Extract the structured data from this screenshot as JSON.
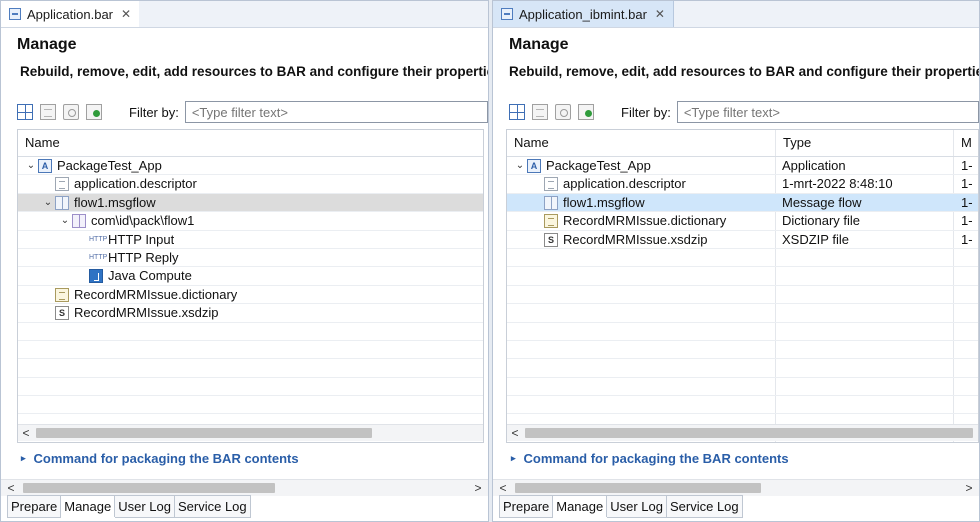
{
  "left": {
    "tab_title": "Application.bar",
    "manage_title": "Manage",
    "manage_desc": "Rebuild, remove, edit, add resources to BAR and configure their properties",
    "filter_label": "Filter by:",
    "filter_placeholder": "<Type filter text>",
    "columns": {
      "name": "Name"
    },
    "rows": [
      {
        "label": "PackageTest_App",
        "icon": "application-icon",
        "twisty": "expanded"
      },
      {
        "label": "application.descriptor",
        "icon": "descriptor-icon",
        "twisty": ""
      },
      {
        "label": "flow1.msgflow",
        "icon": "message-flow-icon",
        "twisty": "expanded"
      },
      {
        "label": "com\\id\\pack\\flow1",
        "icon": "package-icon",
        "twisty": "expanded"
      },
      {
        "label": "HTTP Input",
        "icon": "http-input-icon",
        "twisty": ""
      },
      {
        "label": "HTTP Reply",
        "icon": "http-reply-icon",
        "twisty": ""
      },
      {
        "label": "Java Compute",
        "icon": "java-compute-icon",
        "twisty": ""
      },
      {
        "label": "RecordMRMIssue.dictionary",
        "icon": "dictionary-icon",
        "twisty": ""
      },
      {
        "label": "RecordMRMIssue.xsdzip",
        "icon": "xsdzip-icon",
        "twisty": ""
      }
    ],
    "command_label": "Command for packaging the BAR contents",
    "bottom_tabs": [
      "Prepare",
      "Manage",
      "User Log",
      "Service Log"
    ],
    "active_tab": "Manage"
  },
  "right": {
    "tab_title": "Application_ibmint.bar",
    "manage_title": "Manage",
    "manage_desc": "Rebuild, remove, edit, add resources to BAR and configure their properties",
    "filter_label": "Filter by:",
    "filter_placeholder": "<Type filter text>",
    "columns": {
      "name": "Name",
      "type": "Type",
      "third": "M"
    },
    "rows": [
      {
        "label": "PackageTest_App",
        "type": "Application",
        "third": "1-",
        "icon": "application-icon",
        "twisty": "expanded"
      },
      {
        "label": "application.descriptor",
        "type": "1-mrt-2022  8:48:10",
        "third": "1-",
        "icon": "descriptor-icon",
        "twisty": ""
      },
      {
        "label": "flow1.msgflow",
        "type": "Message flow",
        "third": "1-",
        "icon": "message-flow-icon",
        "twisty": ""
      },
      {
        "label": "RecordMRMIssue.dictionary",
        "type": "Dictionary file",
        "third": "1-",
        "icon": "dictionary-icon",
        "twisty": ""
      },
      {
        "label": "RecordMRMIssue.xsdzip",
        "type": "XSDZIP file",
        "third": "1-",
        "icon": "xsdzip-icon",
        "twisty": ""
      }
    ],
    "command_label": "Command for packaging the BAR contents",
    "bottom_tabs": [
      "Prepare",
      "Manage",
      "User Log",
      "Service Log"
    ],
    "active_tab": "Manage"
  },
  "icon_glyphs": {
    "twisty_expanded": "⌄",
    "close": "✕",
    "triangle_right": "▸",
    "scroll_left": "<",
    "scroll_right": ">"
  }
}
